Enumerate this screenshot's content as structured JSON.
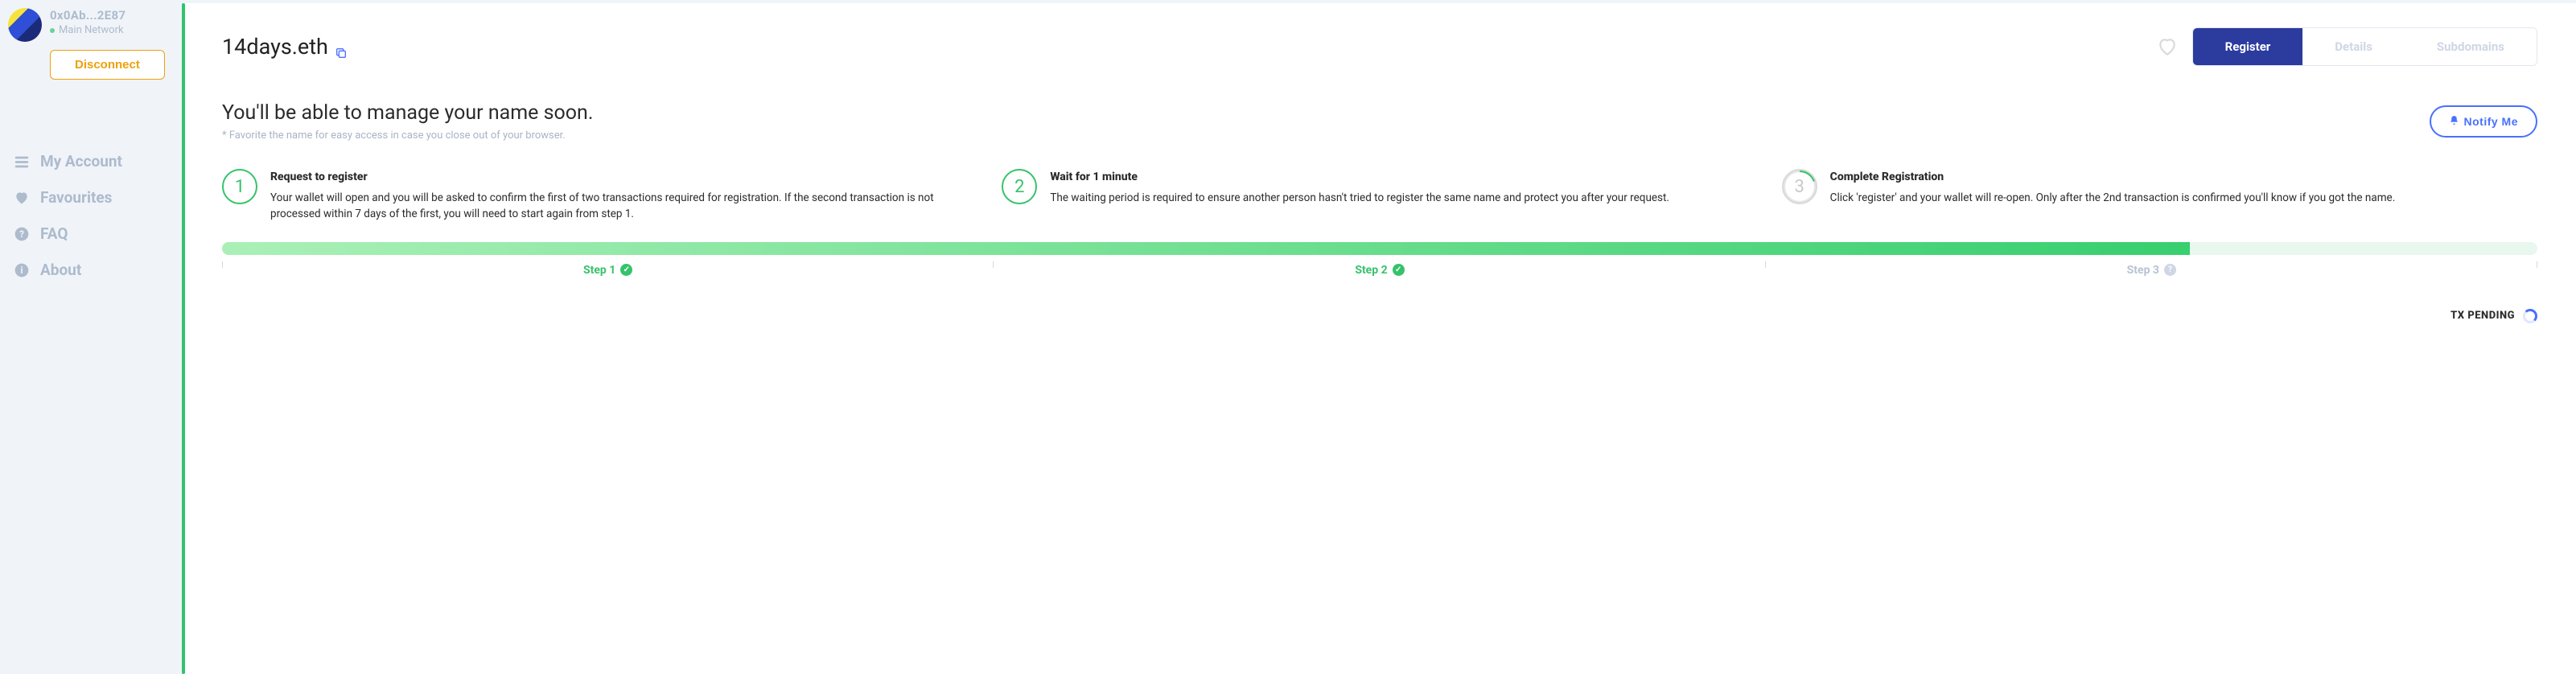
{
  "wallet": {
    "address": "0x0Ab...2E87",
    "network": "Main Network",
    "disconnect": "Disconnect"
  },
  "nav": {
    "account": "My Account",
    "favourites": "Favourites",
    "faq": "FAQ",
    "about": "About"
  },
  "domain": {
    "name": "14days.eth"
  },
  "tabs": {
    "register": "Register",
    "details": "Details",
    "subdomains": "Subdomains"
  },
  "section": {
    "title": "You'll be able to manage your name soon.",
    "subtitle": "* Favorite the name for easy access in case you close out of your browser.",
    "notify": "Notify Me"
  },
  "steps": [
    {
      "num": "1",
      "title": "Request to register",
      "body": "Your wallet will open and you will be asked to confirm the first of two transactions required for registration. If the second transaction is not processed within 7 days of the first, you will need to start again from step 1."
    },
    {
      "num": "2",
      "title": "Wait for 1 minute",
      "body": "The waiting period is required to ensure another person hasn't tried to register the same name and protect you after your request."
    },
    {
      "num": "3",
      "title": "Complete Registration",
      "body": "Click 'register' and your wallet will re-open. Only after the 2nd transaction is confirmed you'll know if you got the name."
    }
  ],
  "stepLabels": {
    "s1": "Step 1",
    "s2": "Step 2",
    "s3": "Step 3"
  },
  "tx": {
    "pending": "TX PENDING"
  }
}
